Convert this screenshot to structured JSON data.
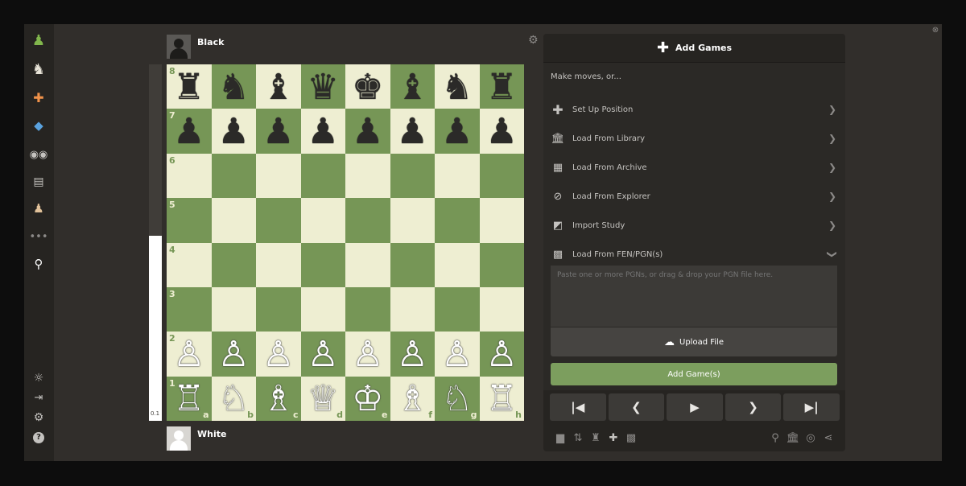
{
  "players": {
    "top": {
      "name": "Black"
    },
    "bottom": {
      "name": "White"
    }
  },
  "eval": {
    "label": "0.1",
    "white_fraction": 0.52
  },
  "board": {
    "ranks": [
      "8",
      "7",
      "6",
      "5",
      "4",
      "3",
      "2",
      "1"
    ],
    "files": [
      "a",
      "b",
      "c",
      "d",
      "e",
      "f",
      "g",
      "h"
    ],
    "pieces": [
      [
        "♜",
        "♞",
        "♝",
        "♛",
        "♚",
        "♝",
        "♞",
        "♜"
      ],
      [
        "♟",
        "♟",
        "♟",
        "♟",
        "♟",
        "♟",
        "♟",
        "♟"
      ],
      [
        "",
        "",
        "",
        "",
        "",
        "",
        "",
        ""
      ],
      [
        "",
        "",
        "",
        "",
        "",
        "",
        "",
        ""
      ],
      [
        "",
        "",
        "",
        "",
        "",
        "",
        "",
        ""
      ],
      [
        "",
        "",
        "",
        "",
        "",
        "",
        "",
        ""
      ],
      [
        "♙",
        "♙",
        "♙",
        "♙",
        "♙",
        "♙",
        "♙",
        "♙"
      ],
      [
        "♖",
        "♘",
        "♗",
        "♕",
        "♔",
        "♗",
        "♘",
        "♖"
      ]
    ],
    "light_color": "#eeeed2",
    "dark_color": "#769656"
  },
  "sidebar": {
    "top_icons": [
      "pawn-icon",
      "puzzle-icon",
      "piece-icon",
      "learn-icon",
      "watch-icon",
      "news-icon",
      "social-icon",
      "more-icon",
      "search-icon"
    ],
    "bottom_icons": [
      "theme-icon",
      "collapse-icon",
      "settings-icon",
      "help-icon"
    ]
  },
  "panel": {
    "title": "Add Games",
    "intro": "Make moves, or...",
    "options": [
      {
        "label": "Set Up Position",
        "icon": "plus-icon"
      },
      {
        "label": "Load From Library",
        "icon": "library-icon"
      },
      {
        "label": "Load From Archive",
        "icon": "archive-icon"
      },
      {
        "label": "Load From Explorer",
        "icon": "compass-icon"
      },
      {
        "label": "Import Study",
        "icon": "study-icon"
      },
      {
        "label": "Load From FEN/PGN(s)",
        "icon": "checker-icon"
      }
    ],
    "pgn_placeholder": "Paste one or more PGNs, or drag & drop your PGN file here.",
    "upload_label": "Upload File",
    "add_button_label": "Add Game(s)",
    "accent_color": "#7c9e5e"
  },
  "nav_buttons": [
    "first-move",
    "previous-move",
    "play",
    "next-move",
    "last-move"
  ],
  "toolbar_icons": [
    "chart-icon",
    "flip-icon",
    "pieces-icon",
    "add-icon",
    "add-board-icon",
    "zoom-icon",
    "library-icon",
    "target-icon",
    "share-icon"
  ]
}
